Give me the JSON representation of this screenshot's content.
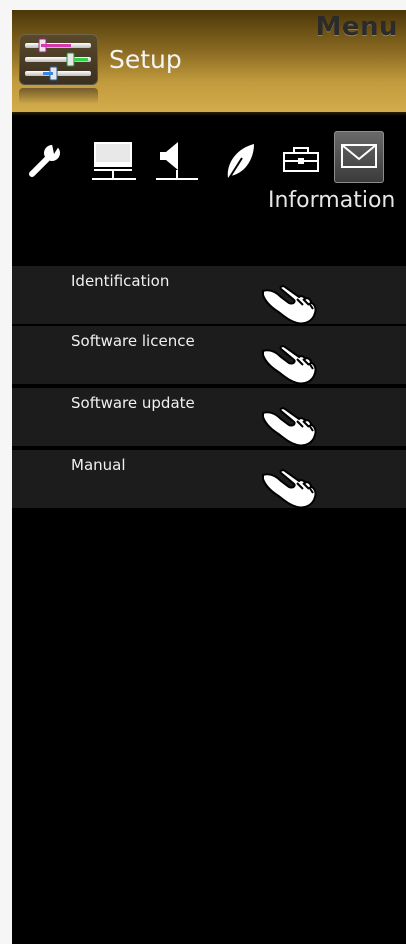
{
  "header": {
    "menu_title": "Menu",
    "section_title": "Setup",
    "section_icon": "settings-sliders-icon"
  },
  "categories": {
    "active_label": "Information",
    "items": [
      {
        "icon": "wrench-icon"
      },
      {
        "icon": "monitor-network-icon"
      },
      {
        "icon": "speaker-network-icon"
      },
      {
        "icon": "leaf-icon"
      },
      {
        "icon": "toolbox-icon"
      },
      {
        "icon": "envelope-icon",
        "active": true
      }
    ]
  },
  "items": [
    {
      "label": "Identification",
      "action_icon": "hand-pointer-icon"
    },
    {
      "label": "Software licence",
      "action_icon": "hand-pointer-icon"
    },
    {
      "label": "Software update",
      "action_icon": "hand-pointer-icon"
    },
    {
      "label": "Manual",
      "action_icon": "hand-pointer-icon"
    }
  ],
  "colors": {
    "header_gold": "#c09a3c",
    "background": "#000000",
    "item_background": "#1c1c1c",
    "text": "#f0f0f0"
  }
}
